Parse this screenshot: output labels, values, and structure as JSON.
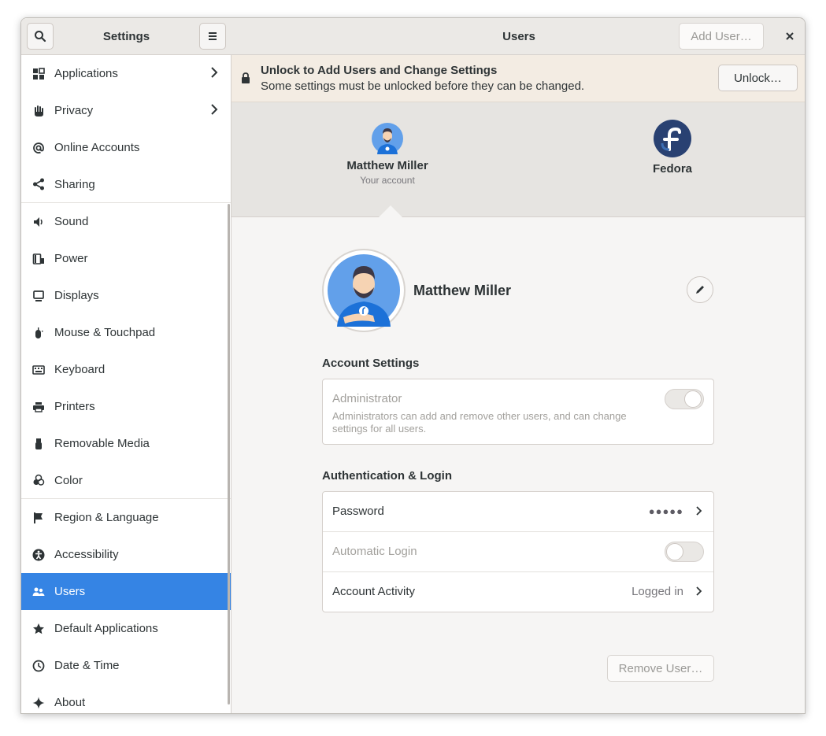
{
  "sidebar": {
    "title": "Settings",
    "items": [
      {
        "label": "Applications",
        "icon": "grid-icon"
      },
      {
        "label": "Privacy",
        "icon": "hand-icon"
      },
      {
        "label": "Online Accounts",
        "icon": "at-icon"
      },
      {
        "label": "Sharing",
        "icon": "share-icon"
      },
      {
        "label": "Sound",
        "icon": "speaker-icon"
      },
      {
        "label": "Power",
        "icon": "power-icon"
      },
      {
        "label": "Displays",
        "icon": "monitor-icon"
      },
      {
        "label": "Mouse & Touchpad",
        "icon": "mouse-icon"
      },
      {
        "label": "Keyboard",
        "icon": "keyboard-icon"
      },
      {
        "label": "Printers",
        "icon": "printer-icon"
      },
      {
        "label": "Removable Media",
        "icon": "usb-icon"
      },
      {
        "label": "Color",
        "icon": "color-icon"
      },
      {
        "label": "Region & Language",
        "icon": "flag-icon"
      },
      {
        "label": "Accessibility",
        "icon": "accessibility-icon"
      },
      {
        "label": "Users",
        "icon": "users-icon"
      },
      {
        "label": "Default Applications",
        "icon": "star-icon"
      },
      {
        "label": "Date & Time",
        "icon": "clock-icon"
      },
      {
        "label": "About",
        "icon": "sparkle-icon"
      }
    ]
  },
  "header": {
    "title": "Users",
    "add_user_label": "Add User…"
  },
  "infobar": {
    "title": "Unlock to Add Users and Change Settings",
    "subtitle": "Some settings must be unlocked before they can be changed.",
    "unlock_label": "Unlock…"
  },
  "carousel": {
    "users": [
      {
        "name": "Matthew Miller",
        "subtitle": "Your account"
      },
      {
        "name": "Fedora",
        "subtitle": ""
      }
    ]
  },
  "user": {
    "full_name": "Matthew Miller"
  },
  "account_settings": {
    "heading": "Account Settings",
    "admin_label": "Administrator",
    "admin_desc_line1": "Administrators can add and remove other users, and can change",
    "admin_desc_line2": "settings for all users.",
    "admin_enabled": false
  },
  "auth": {
    "heading": "Authentication & Login",
    "password_label": "Password",
    "password_value": "●●●●●",
    "autologin_label": "Automatic Login",
    "autologin_enabled": false,
    "activity_label": "Account Activity",
    "activity_value": "Logged in"
  },
  "remove_user_label": "Remove User…",
  "colors": {
    "accent": "#3584e4",
    "fedora_blue": "#294172",
    "infobar_bg": "#f3ece3"
  }
}
